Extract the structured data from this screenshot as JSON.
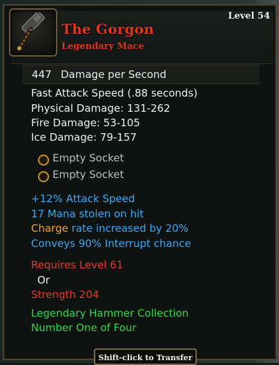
{
  "item": {
    "name": "The Gorgon",
    "type": "Legendary Mace",
    "level": "Level 54",
    "icon": "hammer-icon"
  },
  "dps": {
    "value": "447",
    "label": "Damage per Second"
  },
  "stats": {
    "attack_speed": "Fast Attack Speed (.88 seconds)",
    "physical": "Physical Damage: 131-262",
    "fire": "Fire Damage: 53-105",
    "ice": "Ice Damage: 79-157"
  },
  "sockets": [
    "Empty Socket",
    "Empty Socket"
  ],
  "magic": {
    "attack_speed": "+12% Attack Speed",
    "mana": "17 Mana stolen on hit",
    "charge_word": "Charge",
    "charge_rest": "rate increased by 20%",
    "interrupt": "Conveys 90% Interrupt chance"
  },
  "requirements": {
    "level": "Requires Level 61",
    "or": "Or",
    "strength": "Strength 204"
  },
  "set": {
    "collection": "Legendary Hammer Collection",
    "position": "Number One of Four"
  },
  "footer": {
    "hint": "Shift-click to Transfer"
  },
  "colors": {
    "name_red": "#e4331e",
    "magic_blue": "#3aa8f2",
    "charge_orange": "#f0a33b",
    "requirement_red": "#e23b2a",
    "set_green": "#2ed84a"
  }
}
